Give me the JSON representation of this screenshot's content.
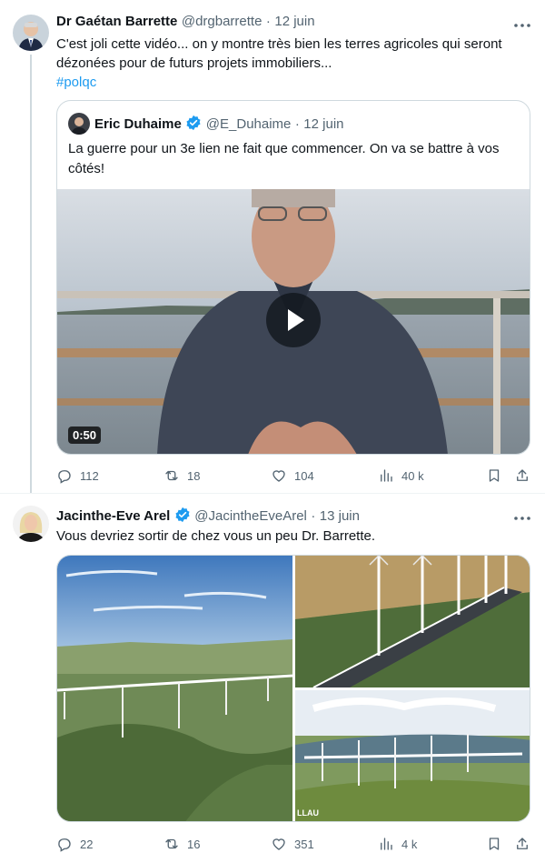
{
  "tweet1": {
    "author_name": "Dr Gaétan Barrette",
    "handle": "@drgbarrette",
    "separator": "·",
    "date": "12 juin",
    "text_line1": "C'est joli cette vidéo... on y montre très bien les terres agricoles qui seront",
    "text_line2": "dézonées pour de futurs projets immobiliers...",
    "hashtag": "#polqc",
    "avatar_icon": "person-avatar",
    "more_icon": "more-horizontal-icon",
    "quote": {
      "author_name": "Eric Duhaime",
      "handle": "@E_Duhaime",
      "separator": "·",
      "date": "12 juin",
      "text_line1": "La guerre pour un 3e lien ne fait que commencer. On va se battre à vos",
      "text_line2": "côtés!",
      "video_duration": "0:50",
      "verified_color": "#1d9bf0"
    },
    "actions": {
      "replies": "112",
      "reposts": "18",
      "likes": "104",
      "views": "40 k"
    }
  },
  "tweet2": {
    "author_name": "Jacinthe-Eve Arel",
    "handle": "@JacintheEveArel",
    "separator": "·",
    "date": "13 juin",
    "text": "Vous devriez sortir de chez vous un peu Dr. Barrette.",
    "verified_color": "#1d9bf0",
    "image_caption_fragment": "LLAU",
    "actions": {
      "replies": "22",
      "reposts": "16",
      "likes": "351",
      "views": "4 k"
    }
  },
  "colors": {
    "text_primary": "#0f1419",
    "text_secondary": "#536471",
    "accent": "#1d9bf0",
    "border": "#cfd9de"
  }
}
